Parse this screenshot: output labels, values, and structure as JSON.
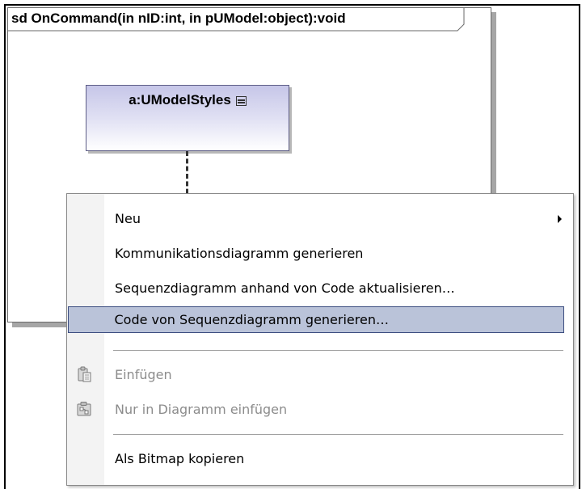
{
  "diagram": {
    "frame_title": "sd OnCommand(in nID:int, in pUModel:object):void",
    "lifeline_label": "a:UModelStyles",
    "lifeline_icon": "compartment-icon"
  },
  "context_menu": {
    "items": [
      {
        "label": "Neu",
        "has_submenu": true,
        "state": "enabled"
      },
      {
        "label": "Kommunikationsdiagramm generieren",
        "state": "enabled"
      },
      {
        "label": "Sequenzdiagramm anhand von Code aktualisieren…",
        "state": "enabled"
      },
      {
        "label": "Code von Sequenzdiagramm generieren…",
        "state": "selected"
      },
      {
        "label": "Einfügen",
        "icon": "paste-icon",
        "state": "disabled"
      },
      {
        "label": "Nur in Diagramm einfügen",
        "icon": "paste-diagram-icon",
        "state": "disabled"
      },
      {
        "label": "Als Bitmap kopieren",
        "state": "enabled"
      }
    ]
  },
  "colors": {
    "selection_fill": "#bac3d9",
    "selection_border": "#3b4d80",
    "lifeline_gradient_top": "#c6c6e8",
    "disabled_text": "#8c8c8c"
  }
}
